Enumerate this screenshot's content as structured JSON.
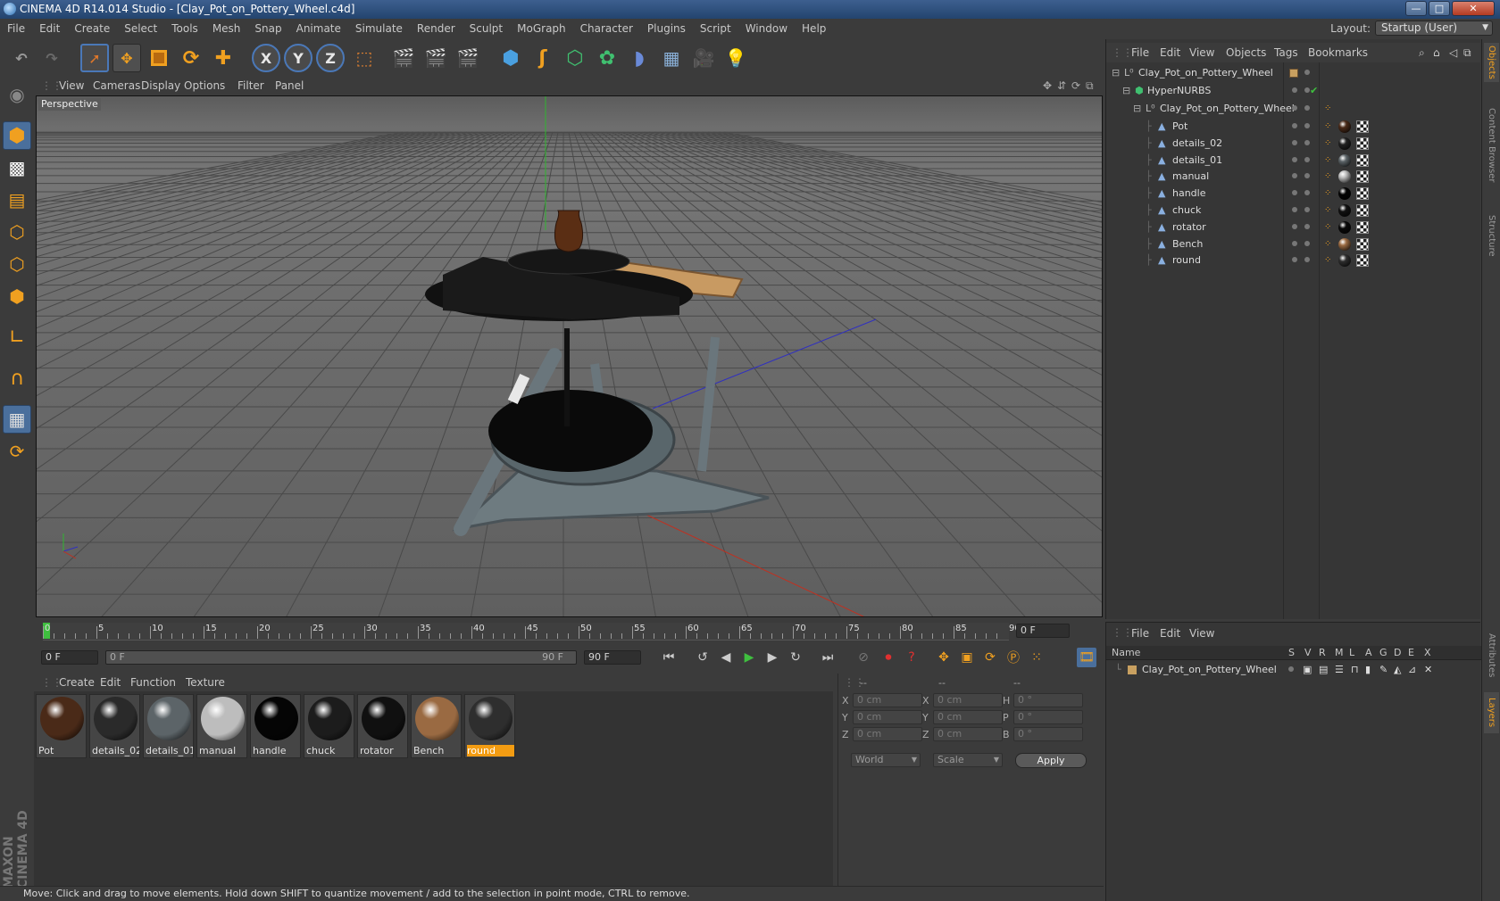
{
  "window": {
    "title": "CINEMA 4D R14.014 Studio - [Clay_Pot_on_Pottery_Wheel.c4d]",
    "minimize": "—",
    "maximize": "□",
    "close": "✕"
  },
  "menubar": {
    "items": [
      "File",
      "Edit",
      "Create",
      "Select",
      "Tools",
      "Mesh",
      "Snap",
      "Animate",
      "Simulate",
      "Render",
      "Sculpt",
      "MoGraph",
      "Character",
      "Plugins",
      "Script",
      "Window",
      "Help"
    ],
    "layout_label": "Layout:",
    "layout_value": "Startup (User)"
  },
  "toolbar": {
    "axis_x": "X",
    "axis_y": "Y",
    "axis_z": "Z"
  },
  "viewport": {
    "menu": [
      "View",
      "Cameras",
      "Display",
      "Options",
      "Filter",
      "Panel"
    ],
    "label": "Perspective"
  },
  "timeline": {
    "ticks": [
      "0",
      "5",
      "10",
      "15",
      "20",
      "25",
      "30",
      "35",
      "40",
      "45",
      "50",
      "55",
      "60",
      "65",
      "70",
      "75",
      "80",
      "85",
      "90"
    ],
    "current_frame": "0 F",
    "start_frame": "0 F",
    "range_start": "0 F",
    "range_end": "90 F",
    "end_frame": "90 F"
  },
  "materials": {
    "menu": [
      "Create",
      "Edit",
      "Function",
      "Texture"
    ],
    "items": [
      {
        "name": "Pot",
        "color": "#4a2a18"
      },
      {
        "name": "details_02",
        "color": "#2a2a2a"
      },
      {
        "name": "details_01",
        "color": "#5c6468"
      },
      {
        "name": "manual",
        "color": "#bdbdbd"
      },
      {
        "name": "handle",
        "color": "#050505"
      },
      {
        "name": "chuck",
        "color": "#1c1c1c"
      },
      {
        "name": "rotator",
        "color": "#101010"
      },
      {
        "name": "Bench",
        "color": "#9a6a42"
      },
      {
        "name": "round",
        "color": "#2e2e2e"
      }
    ],
    "selected": "round"
  },
  "coordinates": {
    "headers": [
      "--",
      "--",
      "--"
    ],
    "rows": [
      {
        "a": "X",
        "av": "0 cm",
        "b": "X",
        "bv": "0 cm",
        "c": "H",
        "cv": "0 °"
      },
      {
        "a": "Y",
        "av": "0 cm",
        "b": "Y",
        "bv": "0 cm",
        "c": "P",
        "cv": "0 °"
      },
      {
        "a": "Z",
        "av": "0 cm",
        "b": "Z",
        "bv": "0 cm",
        "c": "B",
        "cv": "0 °"
      }
    ],
    "mode": "World",
    "scale": "Scale",
    "apply": "Apply"
  },
  "objects": {
    "menu": [
      "File",
      "Edit",
      "View",
      "Objects",
      "Tags",
      "Bookmarks"
    ],
    "root": "Clay_Pot_on_Pottery_Wheel",
    "hypernurbs": "HyperNURBS",
    "group": "Clay_Pot_on_Pottery_Wheel",
    "children": [
      {
        "name": "Pot",
        "mat": "#4a2a18"
      },
      {
        "name": "details_02",
        "mat": "#222"
      },
      {
        "name": "details_01",
        "mat": "#5c6468"
      },
      {
        "name": "manual",
        "mat": "#bdbdbd"
      },
      {
        "name": "handle",
        "mat": "#050505"
      },
      {
        "name": "chuck",
        "mat": "#111"
      },
      {
        "name": "rotator",
        "mat": "#0a0a0a"
      },
      {
        "name": "Bench",
        "mat": "#9a6a42"
      },
      {
        "name": "round",
        "mat": "#2e2e2e"
      }
    ]
  },
  "layers": {
    "menu": [
      "File",
      "Edit",
      "View"
    ],
    "columns": [
      "Name",
      "S",
      "V",
      "R",
      "M",
      "L",
      "A",
      "G",
      "D",
      "E",
      "X"
    ],
    "row": "Clay_Pot_on_Pottery_Wheel"
  },
  "side_tabs": [
    "Objects",
    "Content Browser",
    "Structure",
    "Attributes",
    "Layers"
  ],
  "status": "Move: Click and drag to move elements. Hold down SHIFT to quantize movement / add to the selection in point mode, CTRL to remove.",
  "branding": "MAXON CINEMA 4D"
}
